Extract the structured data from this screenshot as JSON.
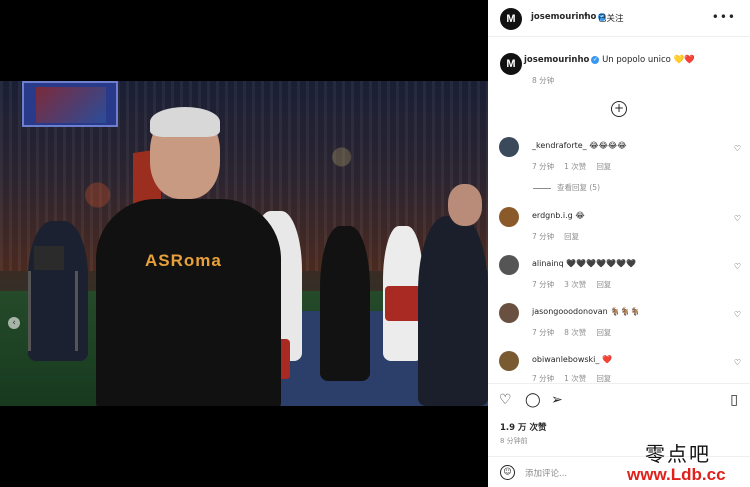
{
  "post": {
    "username": "josemourinho",
    "avatar_initial": "M",
    "follow_sep": "•",
    "follow_label": "已关注",
    "more_icon": "more-options-icon",
    "caption": "Un popolo unico 💛❤️",
    "caption_time": "8 分钟",
    "load_more_icon": "plus-circle-icon",
    "photo": {
      "shirt_text": "ASRoma",
      "nav_icon": "carousel-prev-icon",
      "nav_glyph": "‹"
    }
  },
  "comments": [
    {
      "user": "_kendraforte_",
      "text": "😂😂😂😂",
      "time": "7 分钟",
      "likes": "1 次赞",
      "reply": "回复",
      "avatar_color": "#3a4a5a"
    },
    {
      "user": "erdgnb.i.g",
      "text": "😂",
      "time": "7 分钟",
      "likes": "",
      "reply": "回复",
      "avatar_color": "#8a5a2a"
    },
    {
      "user": "alinainq",
      "text": "🖤🖤🖤🖤🖤🖤🖤",
      "time": "7 分钟",
      "likes": "3 次赞",
      "reply": "回复",
      "avatar_color": "#555555"
    },
    {
      "user": "jasongooodonovan",
      "text": "🐐🐐🐐",
      "time": "7 分钟",
      "likes": "8 次赞",
      "reply": "回复",
      "avatar_color": "#6a5040"
    },
    {
      "user": "obiwanlebowski_",
      "text": "❤️",
      "time": "7 分钟",
      "likes": "1 次赞",
      "reply": "回复",
      "avatar_color": "#7a5a30"
    }
  ],
  "view_replies": "查看回复 (5)",
  "actions": {
    "like_icon": "heart-icon",
    "comment_icon": "comment-icon",
    "share_icon": "share-icon",
    "save_icon": "bookmark-icon",
    "likes": "1.9 万 次赞",
    "time_ago": "8 分钟前",
    "add_comment_placeholder": "添加评论...",
    "emoji_icon": "emoji-icon"
  },
  "watermark": {
    "line1": "零点吧",
    "line2": "www.Ldb.cc"
  }
}
